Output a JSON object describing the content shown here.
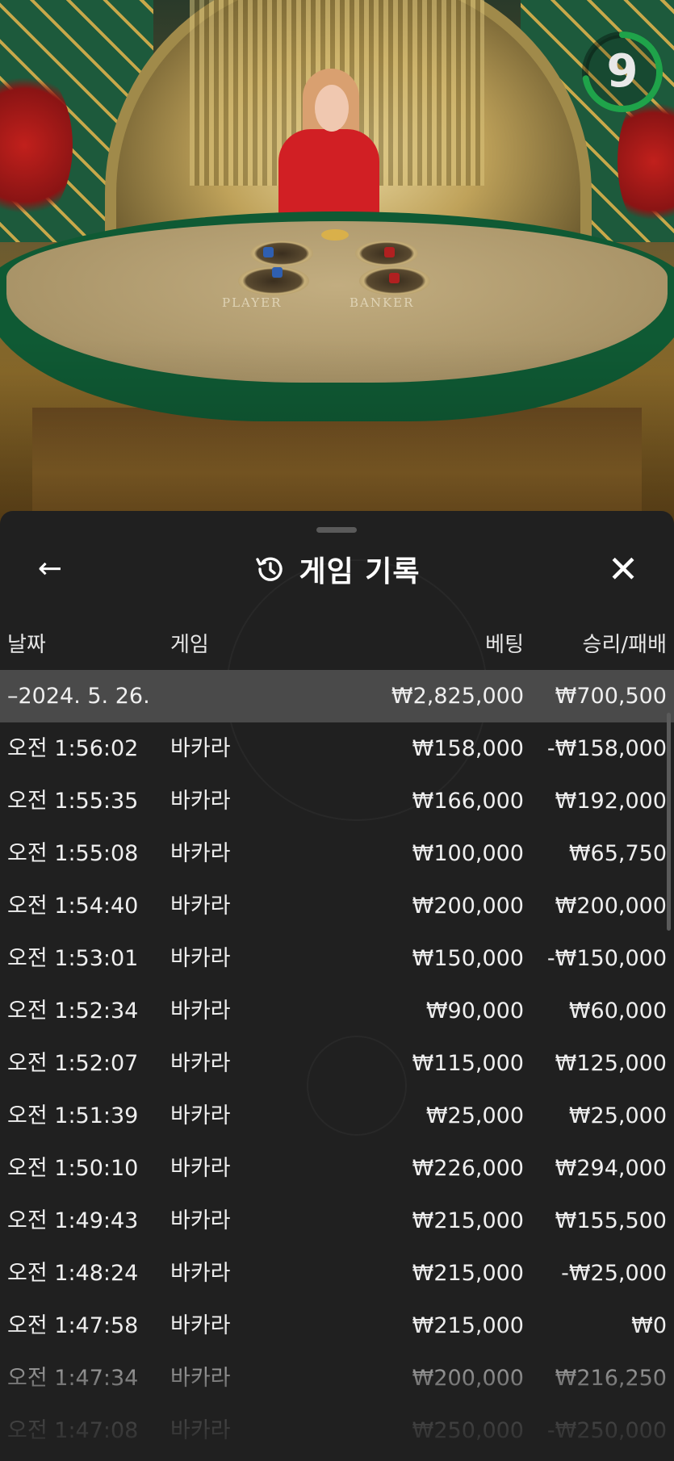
{
  "timer": {
    "value": "9",
    "progress": 0.72,
    "color": "#1fa34a"
  },
  "table_felt": {
    "player_label": "PLAYER",
    "banker_label": "BANKER"
  },
  "sheet": {
    "title": "게임 기록",
    "icons": {
      "back": "arrow-left-icon",
      "history": "history-icon",
      "close": "close-icon"
    }
  },
  "columns": {
    "date": "날짜",
    "game": "게임",
    "bet": "베팅",
    "win_loss": "승리/패배"
  },
  "summary": {
    "date": "–2024. 5. 26.",
    "bet": "₩2,825,000",
    "win_loss": "₩700,500"
  },
  "rows": [
    {
      "time": "오전 1:56:02",
      "game": "바카라",
      "bet": "₩158,000",
      "win_loss": "-₩158,000"
    },
    {
      "time": "오전 1:55:35",
      "game": "바카라",
      "bet": "₩166,000",
      "win_loss": "₩192,000"
    },
    {
      "time": "오전 1:55:08",
      "game": "바카라",
      "bet": "₩100,000",
      "win_loss": "₩65,750"
    },
    {
      "time": "오전 1:54:40",
      "game": "바카라",
      "bet": "₩200,000",
      "win_loss": "₩200,000"
    },
    {
      "time": "오전 1:53:01",
      "game": "바카라",
      "bet": "₩150,000",
      "win_loss": "-₩150,000"
    },
    {
      "time": "오전 1:52:34",
      "game": "바카라",
      "bet": "₩90,000",
      "win_loss": "₩60,000"
    },
    {
      "time": "오전 1:52:07",
      "game": "바카라",
      "bet": "₩115,000",
      "win_loss": "₩125,000"
    },
    {
      "time": "오전 1:51:39",
      "game": "바카라",
      "bet": "₩25,000",
      "win_loss": "₩25,000"
    },
    {
      "time": "오전 1:50:10",
      "game": "바카라",
      "bet": "₩226,000",
      "win_loss": "₩294,000"
    },
    {
      "time": "오전 1:49:43",
      "game": "바카라",
      "bet": "₩215,000",
      "win_loss": "₩155,500"
    },
    {
      "time": "오전 1:48:24",
      "game": "바카라",
      "bet": "₩215,000",
      "win_loss": "-₩25,000"
    },
    {
      "time": "오전 1:47:58",
      "game": "바카라",
      "bet": "₩215,000",
      "win_loss": "₩0"
    },
    {
      "time": "오전 1:47:34",
      "game": "바카라",
      "bet": "₩200,000",
      "win_loss": "₩216,250"
    },
    {
      "time": "오전 1:47:08",
      "game": "바카라",
      "bet": "₩250,000",
      "win_loss": "-₩250,000"
    }
  ]
}
